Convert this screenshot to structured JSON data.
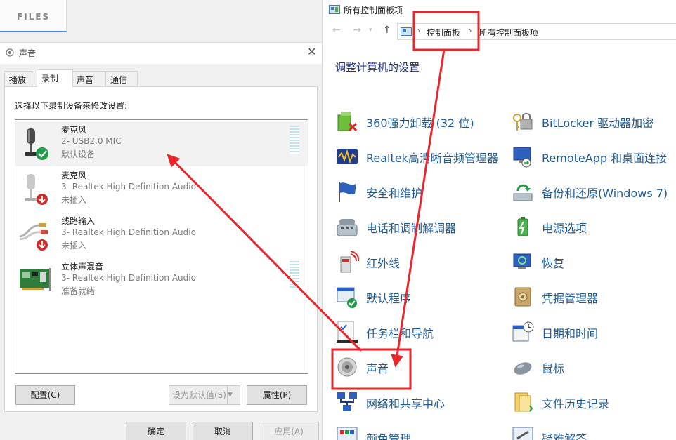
{
  "files_tab": {
    "label": "FILES"
  },
  "sound_dialog": {
    "title": "声音",
    "tabs": [
      "播放",
      "录制",
      "声音",
      "通信"
    ],
    "instruction": "选择以下录制设备来修改设置:",
    "devices": [
      {
        "name": "麦克风",
        "desc": "2- USB2.0 MIC",
        "status": "默认设备",
        "icon": "microphone-default-icon",
        "selected": true
      },
      {
        "name": "麦克风",
        "desc": "3- Realtek High Definition Audio",
        "status": "未插入",
        "icon": "microphone-unplugged-icon",
        "selected": false
      },
      {
        "name": "线路输入",
        "desc": "3- Realtek High Definition Audio",
        "status": "未插入",
        "icon": "line-in-unplugged-icon",
        "selected": false
      },
      {
        "name": "立体声混音",
        "desc": "3- Realtek High Definition Audio",
        "status": "准备就绪",
        "icon": "stereo-mix-board-icon",
        "selected": false
      }
    ],
    "configure_label": "配置(C)",
    "set_default_label": "设为默认值(S)",
    "properties_label": "属性(P)",
    "ok_label": "确定",
    "cancel_label": "取消",
    "apply_label": "应用(A)"
  },
  "control_panel": {
    "title": "所有控制面板项",
    "breadcrumb": [
      "控制面板",
      "所有控制面板项"
    ],
    "heading": "调整计算机的设置",
    "items_left": [
      {
        "label": "360强力卸载 (32 位)",
        "icon": "uninstaller-icon"
      },
      {
        "label": "Realtek高清晰音频管理器",
        "icon": "realtek-audio-icon"
      },
      {
        "label": "安全和维护",
        "icon": "security-flag-icon"
      },
      {
        "label": "电话和调制解调器",
        "icon": "phone-modem-icon"
      },
      {
        "label": "红外线",
        "icon": "infrared-icon"
      },
      {
        "label": "默认程序",
        "icon": "default-programs-icon"
      },
      {
        "label": "任务栏和导航",
        "icon": "taskbar-icon"
      },
      {
        "label": "声音",
        "icon": "speaker-icon"
      },
      {
        "label": "网络和共享中心",
        "icon": "network-icon"
      },
      {
        "label": "颜色管理",
        "icon": "color-management-icon"
      }
    ],
    "items_right": [
      {
        "label": "BitLocker 驱动器加密",
        "icon": "bitlocker-key-icon"
      },
      {
        "label": "RemoteApp 和桌面连接",
        "icon": "remoteapp-icon"
      },
      {
        "label": "备份和还原(Windows 7)",
        "icon": "backup-restore-icon"
      },
      {
        "label": "电源选项",
        "icon": "power-options-icon"
      },
      {
        "label": "恢复",
        "icon": "recovery-icon"
      },
      {
        "label": "凭据管理器",
        "icon": "credential-vault-icon"
      },
      {
        "label": "日期和时间",
        "icon": "calendar-clock-icon"
      },
      {
        "label": "鼠标",
        "icon": "mouse-icon"
      },
      {
        "label": "文件历史记录",
        "icon": "file-history-icon"
      },
      {
        "label": "疑难解答",
        "icon": "troubleshooting-icon"
      }
    ]
  },
  "colors": {
    "annotation_red": "#e8262b",
    "link_green": "#1e5a96",
    "heading_blue": "#1e3287",
    "selection_gray": "#f2f2f2"
  }
}
